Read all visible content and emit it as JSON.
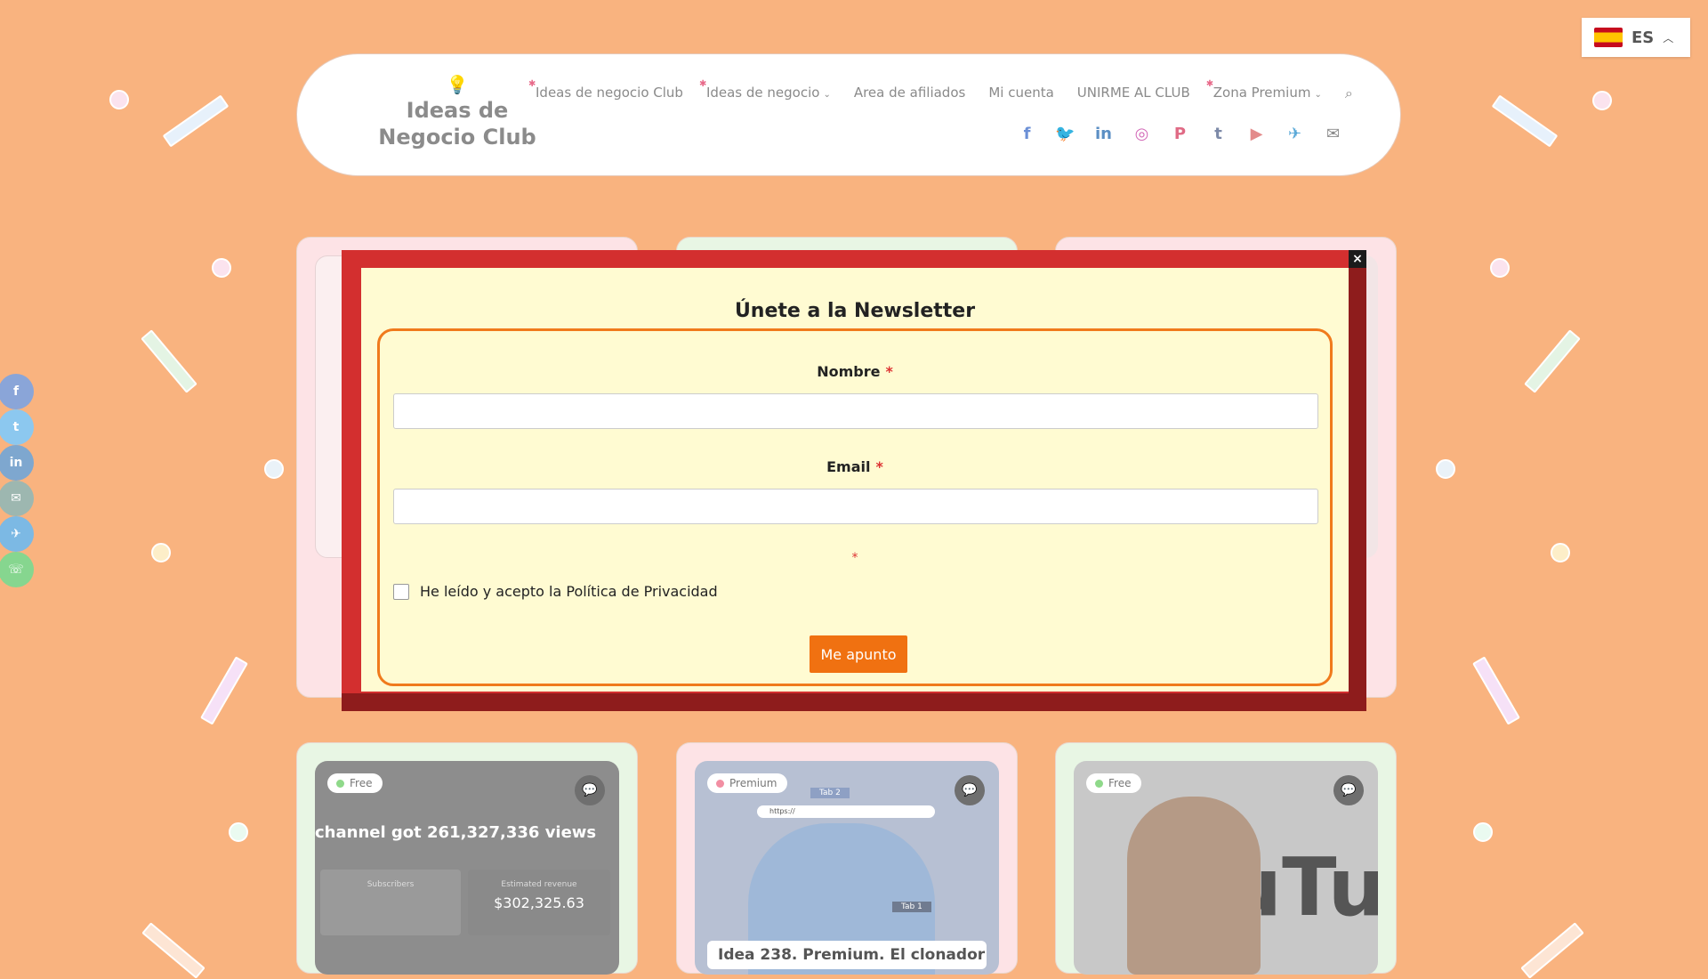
{
  "header": {
    "logo_line1": "Ideas de",
    "logo_line2": "Negocio Club",
    "nav": [
      {
        "label": "Ideas de negocio Club",
        "star": true,
        "chevron": false
      },
      {
        "label": "Ideas de negocio",
        "star": true,
        "chevron": true
      },
      {
        "label": "Area de afiliados",
        "star": false,
        "chevron": false
      },
      {
        "label": "Mi cuenta",
        "star": false,
        "chevron": false
      },
      {
        "label": "UNIRME AL CLUB",
        "star": false,
        "chevron": false
      },
      {
        "label": "Zona Premium",
        "star": true,
        "chevron": true
      }
    ],
    "social_icons": [
      "facebook-icon",
      "twitter-icon",
      "linkedin-icon",
      "instagram-icon",
      "pinterest-icon",
      "tumblr-icon",
      "youtube-icon",
      "telegram-icon",
      "email-icon"
    ]
  },
  "language": {
    "code": "ES",
    "flag": "spain-flag-icon"
  },
  "share_bar": [
    "facebook-icon",
    "twitter-icon",
    "linkedin-icon",
    "email-icon",
    "telegram-icon",
    "whatsapp-icon"
  ],
  "modal": {
    "title": "Únete a la Newsletter",
    "name_label": "Nombre",
    "email_label": "Email",
    "required_mark": "*",
    "privacy_label": "He leído y acepto la Política de Privacidad",
    "submit_label": "Me apunto",
    "close_label": "×"
  },
  "cards": [
    {
      "badge": "Free",
      "image_text": "channel got 261,327,336 views",
      "stat_label_1": "Subscribers",
      "stat_label_2": "Estimated revenue",
      "stat_value_2": "$302,325.63"
    },
    {
      "badge": "Premium",
      "image_tab1": "Tab 2",
      "image_tab2": "Tab 1",
      "image_url": "https://",
      "caption": "Idea 238. Premium. El clonador"
    },
    {
      "badge": "Free",
      "image_text": "uTu"
    }
  ],
  "colors": {
    "background": "#f9b37f",
    "modal_red": "#d32f2f",
    "modal_shadow": "#8e1c1c",
    "modal_inner": "#fffbd2",
    "accent_orange": "#f07111",
    "free_dot": "#8fd98a",
    "premium_dot": "#f28fa3"
  }
}
